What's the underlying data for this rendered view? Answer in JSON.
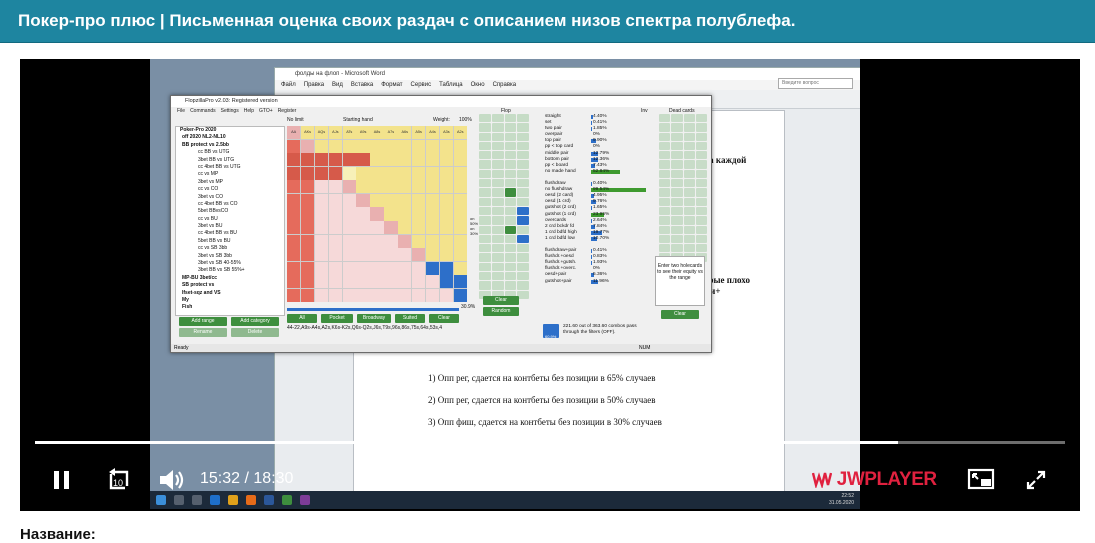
{
  "page": {
    "title": "Покер-про плюс | Письменная оценка своих раздач с описанием низов спектра полублефа.",
    "below_label": "Название:",
    "header_color": "#1e85a0"
  },
  "player": {
    "current_time": "15:32",
    "separator": "/",
    "duration": "18:30",
    "progress_fraction": 0.838,
    "brand": "JWPLAYER",
    "brand_color": "#e0213f",
    "icons": [
      "pause-icon",
      "rewind-10-icon",
      "volume-icon",
      "picture-in-picture-icon",
      "fullscreen-icon"
    ],
    "rewind_label": "10"
  },
  "word": {
    "title": "фолды на флоп - Microsoft Word",
    "menu": [
      "Файл",
      "Правка",
      "Вид",
      "Вставка",
      "Формат",
      "Сервис",
      "Таблица",
      "Окно",
      "Справка"
    ],
    "search_placeholder": "Введите вопрос",
    "doc_lines": [
      "1)   Опп рег, сдается на контбеты без позиции в 65% случаев",
      "2)   Опп рег, сдается на контбеты без позиции в 50% случаев",
      "3)   Опп фиш, сдается на контбеты без позиции в 30% случаев"
    ],
    "right_fragments": [
      "на каждой",
      "орые плохо",
      "ми+"
    ]
  },
  "flopzilla": {
    "title": "FlopzillaPro v2.03: Registered version",
    "menu": [
      "File",
      "Commands",
      "Settings",
      "Help",
      "GTO+",
      "Register"
    ],
    "limit": "No limit",
    "starting_hand": "Starting hand",
    "weight_label": "Weight:",
    "weight_value": "100%",
    "flop_label": "Flop",
    "inv_label": "Inv",
    "dead_cards_label": "Dead cards",
    "tree": [
      "Poker-Pro 2020",
      "off 2020 NL2-NL10",
      "BB protect vs 2.5bb",
      "cc BB vs UTG",
      "3bet BB vs UTG",
      "cc 4bet BB vs UTG",
      "cc vs MP",
      "3bet vs MP",
      "cc vs CO",
      "3bet vs CO",
      "cc 4bet BB vs CO",
      "5bet BBvsCO",
      "cc vs BU",
      "3bet vs BU",
      "cc 4bet BB vs BU",
      "5bet BB vs BU",
      "cc vs SB 3bb",
      "3bet vs SB 3bb",
      "3bet vs SB 40-55%",
      "3bet BB vs SB 55%+",
      "MP-BU 3bet/cc",
      "SB protect vs",
      "Ifset-sqz and VS",
      "My",
      "Fish"
    ],
    "buttons": {
      "add_range": "Add range",
      "add_category": "Add category",
      "rename": "Rename",
      "delete": "Delete",
      "all": "All",
      "pocket": "Pocket",
      "broadway": "Broadway",
      "suited": "Suited",
      "clear": "Clear",
      "random": "Random",
      "enter_clear": "Clear"
    },
    "combo_list": "44-22,A9s-A4s,A2s,K6s-K2s,Q6s-Q2s,J6s,T9s,96s,86s,75s,64s,53s,4",
    "percent": "30.9%",
    "stats": [
      {
        "name": "straight",
        "val": "4.40%",
        "v": 4.4
      },
      {
        "name": "set",
        "val": "0.41%",
        "v": 0.41
      },
      {
        "name": "two pair",
        "val": "1.85%",
        "v": 1.85
      },
      {
        "name": "overpair",
        "val": "0%",
        "v": 0
      },
      {
        "name": "top pair",
        "val": "9.90%",
        "v": 9.9
      },
      {
        "name": "pp < top card",
        "val": "0%",
        "v": 0
      },
      {
        "name": "middle pair",
        "val": "12.79%",
        "v": 12.79
      },
      {
        "name": "bottom pair",
        "val": "12.36%",
        "v": 12.36
      },
      {
        "name": "pp < board",
        "val": "7.43%",
        "v": 7.43
      },
      {
        "name": "no made hand",
        "val": "52.84%",
        "v": 52.84
      },
      {
        "name": "",
        "val": "",
        "v": 0
      },
      {
        "name": "flushdraw",
        "val": "0.40%",
        "v": 0.4
      },
      {
        "name": "no flushdraw",
        "val": "99.54%",
        "v": 99.54
      },
      {
        "name": "oesd (2 card)",
        "val": "4.95%",
        "v": 4.95
      },
      {
        "name": "oesd (1 crd)",
        "val": "9.76%",
        "v": 9.76
      },
      {
        "name": "gutshot (2 crd)",
        "val": "1.65%",
        "v": 1.65
      },
      {
        "name": "gutshot (1 crd)",
        "val": "23.95%",
        "v": 23.95
      },
      {
        "name": "overcards",
        "val": "2.64%",
        "v": 2.64
      },
      {
        "name": "2 crd bckdr fd",
        "val": "7.84%",
        "v": 7.84
      },
      {
        "name": "1 crd bdfd high",
        "val": "19.77%",
        "v": 19.77
      },
      {
        "name": "1 crd bdfd low",
        "val": "10.70%",
        "v": 10.7
      },
      {
        "name": "",
        "val": "",
        "v": 0
      },
      {
        "name": "flushdraw+pair",
        "val": "0.41%",
        "v": 0.41
      },
      {
        "name": "flushdr.+oesd",
        "val": "0.83%",
        "v": 0.83
      },
      {
        "name": "flushdr.+gutsh.",
        "val": "1.93%",
        "v": 1.93
      },
      {
        "name": "flushdr.+overc.",
        "val": "0%",
        "v": 0
      },
      {
        "name": "oesd+pair",
        "val": "5.36%",
        "v": 5.36
      },
      {
        "name": "gutshot+pair",
        "val": "11.96%",
        "v": 11.96
      }
    ],
    "equity_label": "60.9%",
    "combos_text": "221.60 out of 363.60 combos pass through the filters (OFF).",
    "enter_holecards": "Enter two holecards to see their equity vs the range",
    "status": "Ready",
    "num": "NUM",
    "grid_labels": [
      "AA",
      "AKs",
      "AQs",
      "AJs",
      "ATs",
      "A9s",
      "A8s",
      "A7s",
      "A6s",
      "A5s",
      "A4s",
      "A3s",
      "A2s"
    ],
    "slider_labels": [
      "on",
      "50%",
      "on",
      "30%"
    ]
  },
  "taskbar": {
    "time": "22:52",
    "date": "31.05.2020"
  }
}
